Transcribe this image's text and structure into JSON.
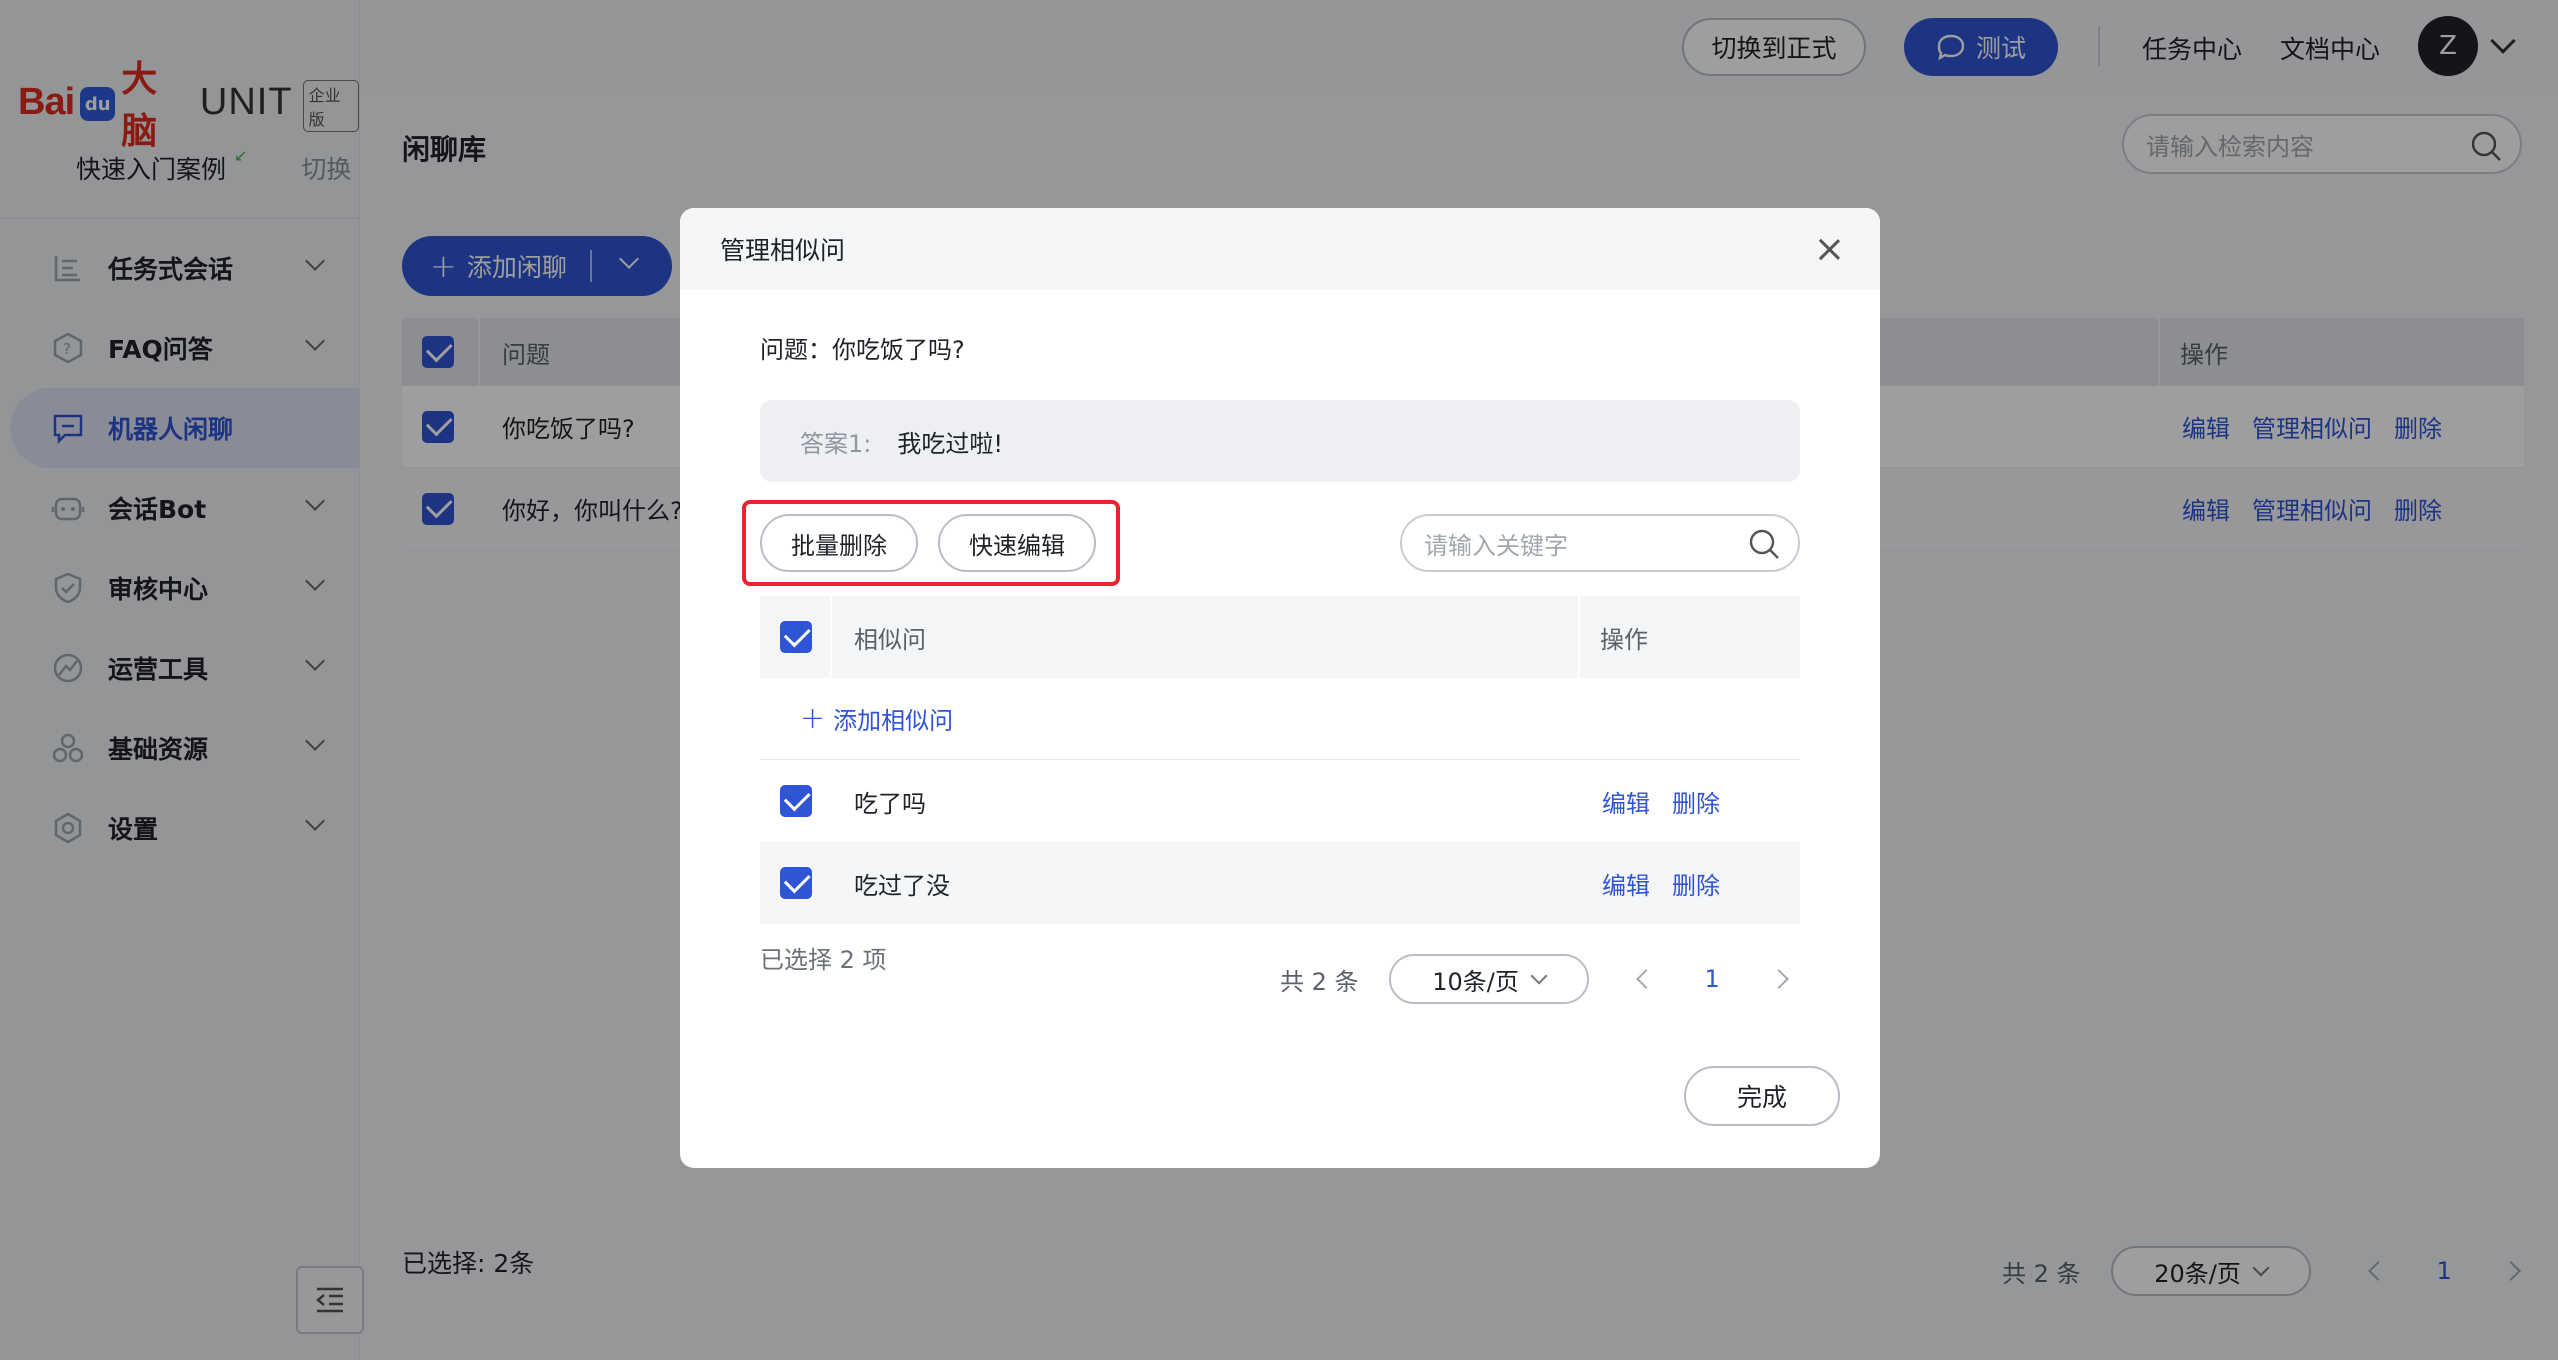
{
  "brand": {
    "logo_bai": "Bai",
    "logo_du": "du",
    "logo_cn": "大脑",
    "logo_unit": "UNIT",
    "logo_badge": "企业版"
  },
  "sidebar": {
    "case_label": "快速入门案例",
    "case_switch": "切换",
    "items": [
      {
        "label": "任务式会话",
        "icon": "task-dialog-icon",
        "active": false,
        "has_caret": true
      },
      {
        "label": "FAQ问答",
        "icon": "faq-icon",
        "active": false,
        "has_caret": true
      },
      {
        "label": "机器人闲聊",
        "icon": "chat-bubble-icon",
        "active": true,
        "has_caret": false
      },
      {
        "label": "会话Bot",
        "icon": "bot-icon",
        "active": false,
        "has_caret": true
      },
      {
        "label": "审核中心",
        "icon": "shield-icon",
        "active": false,
        "has_caret": true
      },
      {
        "label": "运营工具",
        "icon": "operations-icon",
        "active": false,
        "has_caret": true
      },
      {
        "label": "基础资源",
        "icon": "resources-icon",
        "active": false,
        "has_caret": true
      },
      {
        "label": "设置",
        "icon": "settings-icon",
        "active": false,
        "has_caret": true
      }
    ]
  },
  "header": {
    "switch_formal": "切换到正式",
    "test_button": "测试",
    "task_center": "任务中心",
    "doc_center": "文档中心",
    "avatar_letter": "Z"
  },
  "page": {
    "title": "闲聊库",
    "search_placeholder": "请输入检索内容",
    "add_button": "添加闲聊",
    "table": {
      "col_question": "问题",
      "col_ops": "操作",
      "rows": [
        {
          "question": "你吃饭了吗?",
          "ops": [
            "编辑",
            "管理相似问",
            "删除"
          ]
        },
        {
          "question": "你好，你叫什么?",
          "ops": [
            "编辑",
            "管理相似问",
            "删除"
          ]
        }
      ]
    },
    "selected_text": "已选择: 2条",
    "pager": {
      "total": "共 2 条",
      "page_size": "20条/页",
      "current": "1"
    }
  },
  "modal": {
    "title": "管理相似问",
    "question": "问题：你吃饭了吗?",
    "answer_label": "答案1:",
    "answer_text": "我吃过啦!",
    "batch_delete": "批量删除",
    "quick_edit": "快速编辑",
    "search_placeholder": "请输入关键字",
    "col_similar": "相似问",
    "col_ops": "操作",
    "add_similar": "添加相似问",
    "rows": [
      {
        "text": "吃了吗",
        "edit": "编辑",
        "delete": "删除"
      },
      {
        "text": "吃过了没",
        "edit": "编辑",
        "delete": "删除"
      }
    ],
    "selected_text": "已选择 2 项",
    "pager": {
      "total": "共 2 条",
      "page_size": "10条/页",
      "current": "1"
    },
    "done": "完成"
  },
  "colors": {
    "primary": "#2f55d4",
    "brand_red": "#de2c1f",
    "highlight_red": "#e8232f"
  }
}
